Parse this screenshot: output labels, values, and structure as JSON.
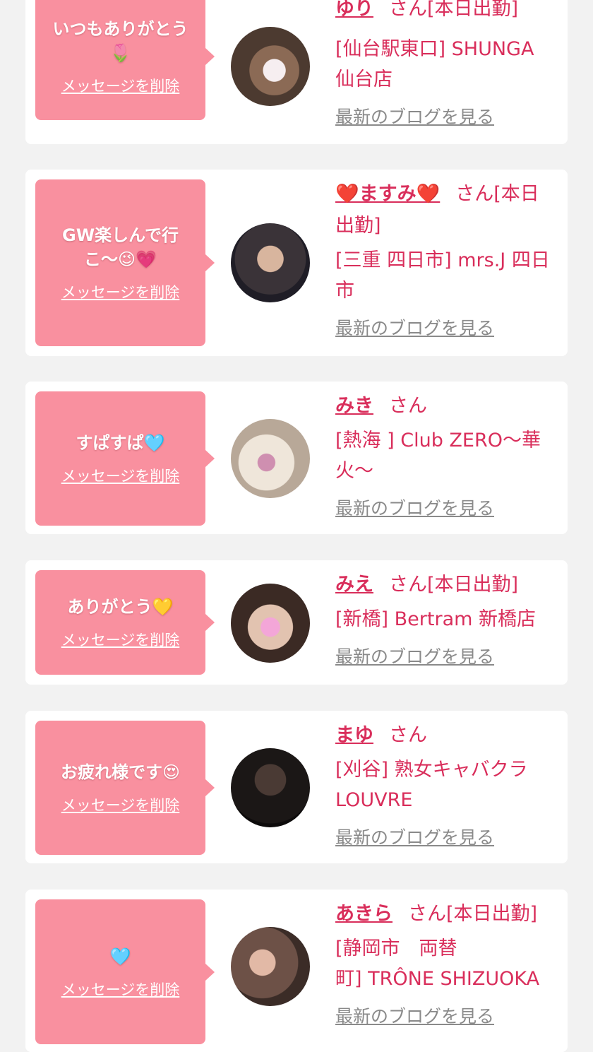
{
  "delete_label": "メッセージを削除",
  "blog_label": "最新のブログを見る",
  "san_suffix": "さん",
  "items": [
    {
      "message_line1": "いつもありがとう",
      "message_line2": "🌷",
      "name": "ゆり",
      "status": "[本日出勤]",
      "shop_line1": "[仙台駅東口] SHUNGA",
      "shop_line2": "仙台店",
      "shop_line3": ""
    },
    {
      "message_line1": "GW楽しんで行",
      "message_line2": "こ～😉💗",
      "name": "❤️ますみ❤️",
      "status": "[本日",
      "status_line2": "出勤]",
      "shop_line1": "[三重 四日市] mrs.J 四日",
      "shop_line2": "市",
      "shop_line3": ""
    },
    {
      "message_line1": "すぱすぱ🩵",
      "message_line2": "",
      "name": "みき",
      "status": "",
      "shop_line1": "[熱海 ] Club ZERO～華",
      "shop_line2": "火～",
      "shop_line3": ""
    },
    {
      "message_line1": "ありがとう💛",
      "message_line2": "",
      "name": "みえ",
      "status": "[本日出勤]",
      "shop_line1": "[新橋] Bertram 新橋店",
      "shop_line2": "",
      "shop_line3": ""
    },
    {
      "message_line1": "お疲れ様です😍",
      "message_line2": "",
      "name": "まゆ",
      "status": "",
      "shop_line1": "[刈谷] 熟女キャバクラ",
      "shop_line2": "LOUVRE",
      "shop_line3": ""
    },
    {
      "message_line1": "🩵",
      "message_line2": "",
      "name": "あきら",
      "status": "[本日出勤]",
      "shop_line1": "[静岡市　両替",
      "shop_line2": "町] TRÔNE SHIZUOKA",
      "shop_line3": ""
    }
  ]
}
